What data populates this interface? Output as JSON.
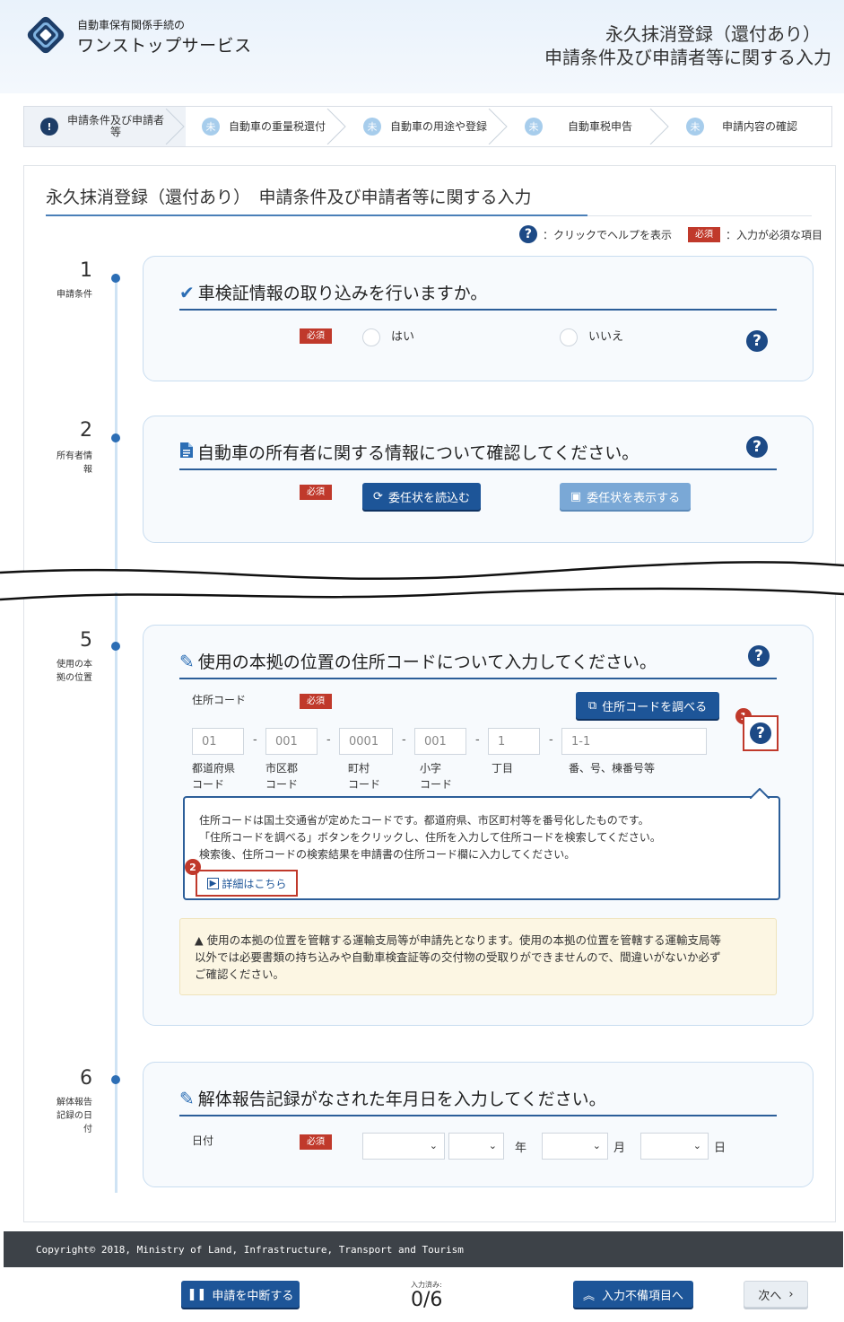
{
  "header": {
    "brand_sub": "自動車保有関係手続の",
    "brand_main": "ワンストップサービス",
    "title_line1": "永久抹消登録（還付あり）",
    "title_line2": "申請条件及び申請者等に関する入力"
  },
  "stepper": [
    {
      "icon": "!",
      "label1": "申請条件及び申請者",
      "label2": "等"
    },
    {
      "icon": "未",
      "label1": "自動車の重量税還付"
    },
    {
      "icon": "未",
      "label1": "自動車の用途や登録"
    },
    {
      "icon": "未",
      "label1": "自動車税申告"
    },
    {
      "icon": "未",
      "label1": "申請内容の確認"
    }
  ],
  "page_title": "永久抹消登録（還付あり）　申請条件及び申請者等に関する入力",
  "legend": {
    "help_text": "：クリックでヘルプを表示",
    "required_badge": "必須",
    "required_text": "：入力が必須な項目"
  },
  "sections": {
    "s1": {
      "num": "1",
      "label": "申請条件",
      "heading": "車検証情報の取り込みを行いますか。",
      "required": "必須",
      "option_yes": "はい",
      "option_no": "いいえ"
    },
    "s2": {
      "num": "2",
      "label1": "所有者情",
      "label2": "報",
      "heading": "自動車の所有者に関する情報について確認してください。",
      "required": "必須",
      "btn_load": "委任状を読込む",
      "btn_show": "委任状を表示する"
    },
    "s5": {
      "num": "5",
      "label1": "使用の本",
      "label2": "拠の位置",
      "heading": "使用の本拠の位置の住所コードについて入力してください。",
      "field_label": "住所コード",
      "required": "必須",
      "btn_lookup": "住所コードを調べる",
      "placeholders": [
        "01",
        "001",
        "0001",
        "001",
        "1",
        "1-1"
      ],
      "labels": {
        "pref1": "都道府県",
        "pref2": "コード",
        "city1": "市区郡",
        "city2": "コード",
        "town1": "町村",
        "town2": "コード",
        "aza1": "小字",
        "aza2": "コード",
        "chome": "丁目",
        "ban": "番、号、棟番号等"
      },
      "help_line1": "住所コードは国土交通省が定めたコードです。都道府県、市区町村等を番号化したものです。",
      "help_line2": "「住所コードを調べる」ボタンをクリックし、住所を入力して住所コードを検索してください。",
      "help_line3": "検索後、住所コードの検索結果を申請書の住所コード欄に入力してください。",
      "detail_link": "詳細はこちら",
      "badge1": "1",
      "badge2": "2",
      "warn_line1": "使用の本拠の位置を管轄する運輸支局等が申請先となります。使用の本拠の位置を管轄する運輸支局等",
      "warn_line2": "以外では必要書類の持ち込みや自動車検査証等の交付物の受取りができませんので、間違いがないか必ず",
      "warn_line3": "ご確認ください。"
    },
    "s6": {
      "num": "6",
      "label1": "解体報告",
      "label2": "記録の日",
      "label3": "付",
      "heading": "解体報告記録がなされた年月日を入力してください。",
      "field_label": "日付",
      "required": "必須",
      "unit_year": "年",
      "unit_month": "月",
      "unit_day": "日"
    }
  },
  "footer": {
    "copyright": "Copyright© 2018, Ministry of Land, Infrastructure, Transport and Tourism"
  },
  "bottom": {
    "btn_suspend": "申請を中断する",
    "progress_label": "入力済み:",
    "progress_value": "0/6",
    "btn_incomplete": "入力不備項目へ",
    "btn_next": "次へ"
  },
  "colors": {
    "primary": "#1d5598",
    "required": "#c0392b",
    "accent_line": "#2c5e99"
  }
}
